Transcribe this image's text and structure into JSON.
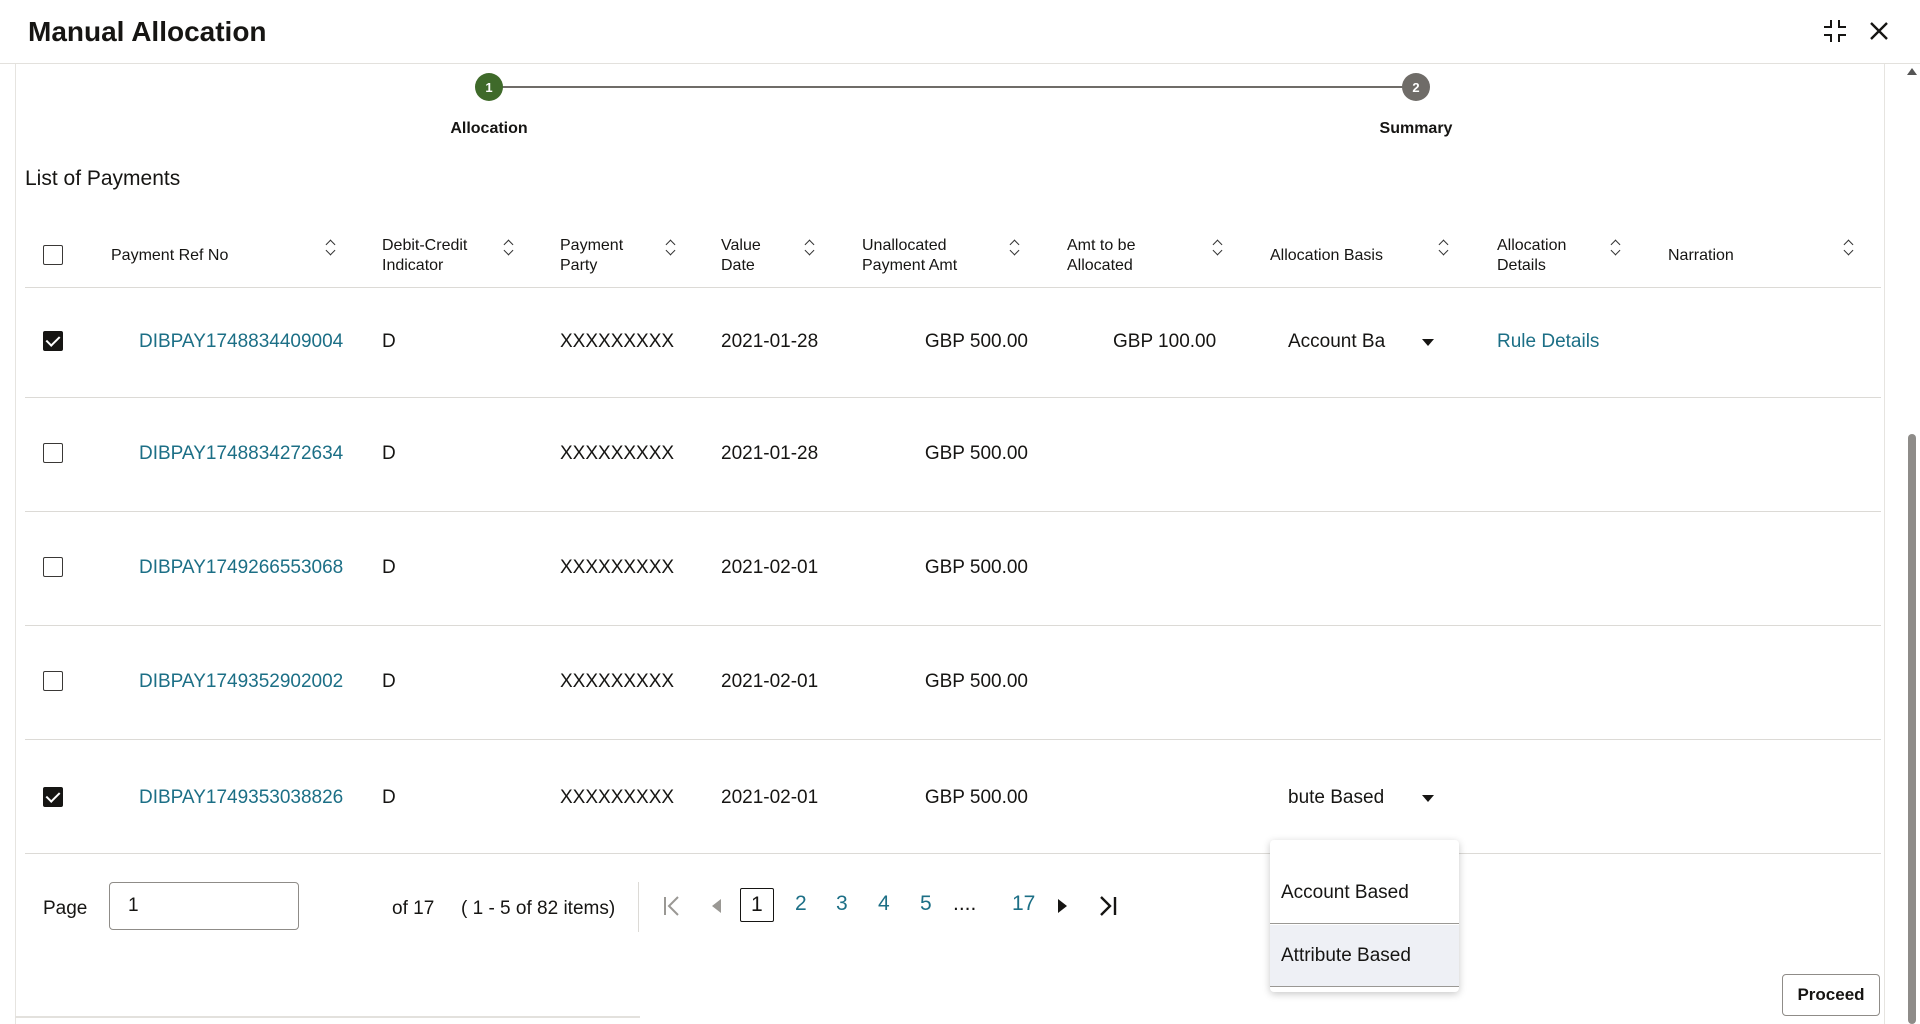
{
  "window": {
    "title": "Manual Allocation"
  },
  "stepper": {
    "steps": [
      {
        "number": "1",
        "label": "Allocation",
        "color": "#3f6a2a"
      },
      {
        "number": "2",
        "label": "Summary",
        "color": "#6f6c68"
      }
    ]
  },
  "section": {
    "title": "List of Payments"
  },
  "columns": {
    "ref": "Payment Ref No",
    "dci_1": "Debit-Credit",
    "dci_2": "Indicator",
    "party_1": "Payment",
    "party_2": "Party",
    "vd_1": "Value",
    "vd_2": "Date",
    "ua_1": "Unallocated",
    "ua_2": "Payment Amt",
    "ab_1": "Amt to be",
    "ab_2": "Allocated",
    "basis": "Allocation Basis",
    "ad_1": "Allocation",
    "ad_2": "Details",
    "narration": "Narration"
  },
  "rows": [
    {
      "checked": true,
      "ref": "DIBPAY1748834409004",
      "dci": "D",
      "party": "XXXXXXXXX",
      "date": "2021-01-28",
      "unalloc": "GBP 500.00",
      "toalloc": "GBP 100.00",
      "basis": "Account Ba",
      "details": "Rule Details"
    },
    {
      "checked": false,
      "ref": "DIBPAY1748834272634",
      "dci": "D",
      "party": "XXXXXXXXX",
      "date": "2021-01-28",
      "unalloc": "GBP 500.00"
    },
    {
      "checked": false,
      "ref": "DIBPAY1749266553068",
      "dci": "D",
      "party": "XXXXXXXXX",
      "date": "2021-02-01",
      "unalloc": "GBP 500.00"
    },
    {
      "checked": false,
      "ref": "DIBPAY1749352902002",
      "dci": "D",
      "party": "XXXXXXXXX",
      "date": "2021-02-01",
      "unalloc": "GBP 500.00"
    },
    {
      "checked": true,
      "ref": "DIBPAY1749353038826",
      "dci": "D",
      "party": "XXXXXXXXX",
      "date": "2021-02-01",
      "unalloc": "GBP 500.00",
      "basis": "bute Based"
    }
  ],
  "pager": {
    "label": "Page",
    "value": "1",
    "of": "of 17",
    "items": "( 1 - 5 of 82 items)",
    "pages": [
      "1",
      "2",
      "3",
      "4",
      "5"
    ],
    "dots": "....",
    "last": "17"
  },
  "dropdown": {
    "options": [
      "Account Based",
      "Attribute Based"
    ]
  },
  "actions": {
    "proceed": "Proceed"
  },
  "colors": {
    "link": "#1c6f86",
    "step_active": "#3f6a2a",
    "step_inactive": "#6f6c68"
  }
}
